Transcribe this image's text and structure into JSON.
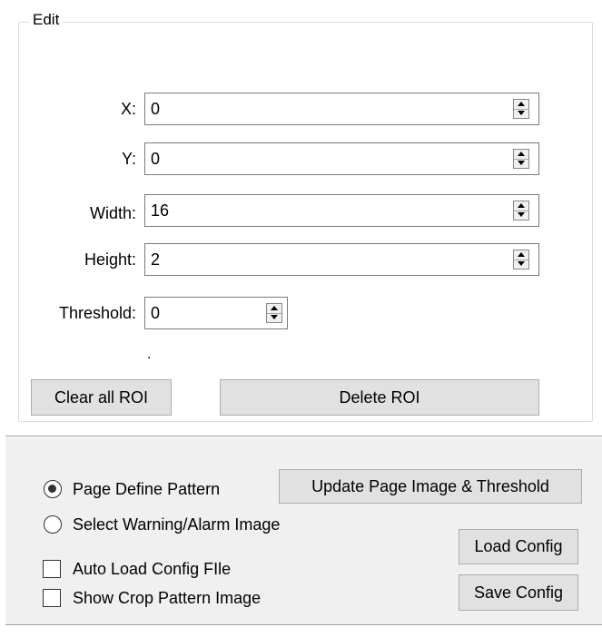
{
  "edit": {
    "title": "Edit",
    "fields": {
      "x": {
        "label": "X:",
        "value": "0"
      },
      "y": {
        "label": "Y:",
        "value": "0"
      },
      "width": {
        "label": "Width:",
        "value": "16"
      },
      "height": {
        "label": "Height:",
        "value": "2"
      },
      "threshold": {
        "label": "Threshold:",
        "value": "0"
      }
    },
    "dot_text": ".",
    "clear_all_label": "Clear all ROI",
    "delete_label": "Delete ROI"
  },
  "bottom": {
    "radio_page_define": {
      "label": "Page Define Pattern",
      "selected": true
    },
    "radio_select_warning": {
      "label": "Select Warning/Alarm Image",
      "selected": false
    },
    "check_auto_load": {
      "label": "Auto Load Config FIle",
      "checked": false
    },
    "check_show_crop": {
      "label": "Show Crop Pattern Image",
      "checked": false
    },
    "update_button_label": "Update Page Image & Threshold",
    "load_config_label": "Load Config",
    "save_config_label": "Save Config"
  }
}
